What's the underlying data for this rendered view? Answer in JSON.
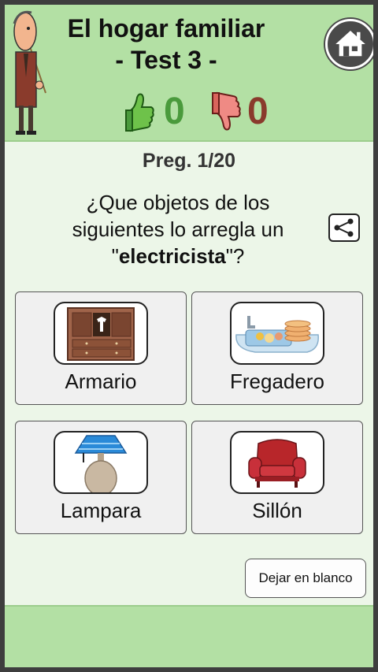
{
  "header": {
    "title_line1": "El hogar familiar",
    "title_line2": "- Test 3 -",
    "home_icon": "home-icon",
    "teacher_icon": "teacher-pointer-icon"
  },
  "score": {
    "correct": "0",
    "wrong": "0",
    "correct_color": "#4a9a3c",
    "wrong_color": "#8a3a2c"
  },
  "question": {
    "counter": "Preg. 1/20",
    "text_before": "¿Que objetos de los siguientes lo arregla un \"",
    "keyword": "electricista",
    "text_after": "\"?",
    "share_icon": "share-icon"
  },
  "options": [
    {
      "label": "Armario",
      "icon": "wardrobe-icon"
    },
    {
      "label": "Fregadero",
      "icon": "sink-icon"
    },
    {
      "label": "Lampara",
      "icon": "lamp-icon"
    },
    {
      "label": "Sillón",
      "icon": "armchair-icon"
    }
  ],
  "blank_button": "Dejar en blanco",
  "colors": {
    "header_bg": "#b3e0a4",
    "page_bg": "#ecf6e8"
  }
}
